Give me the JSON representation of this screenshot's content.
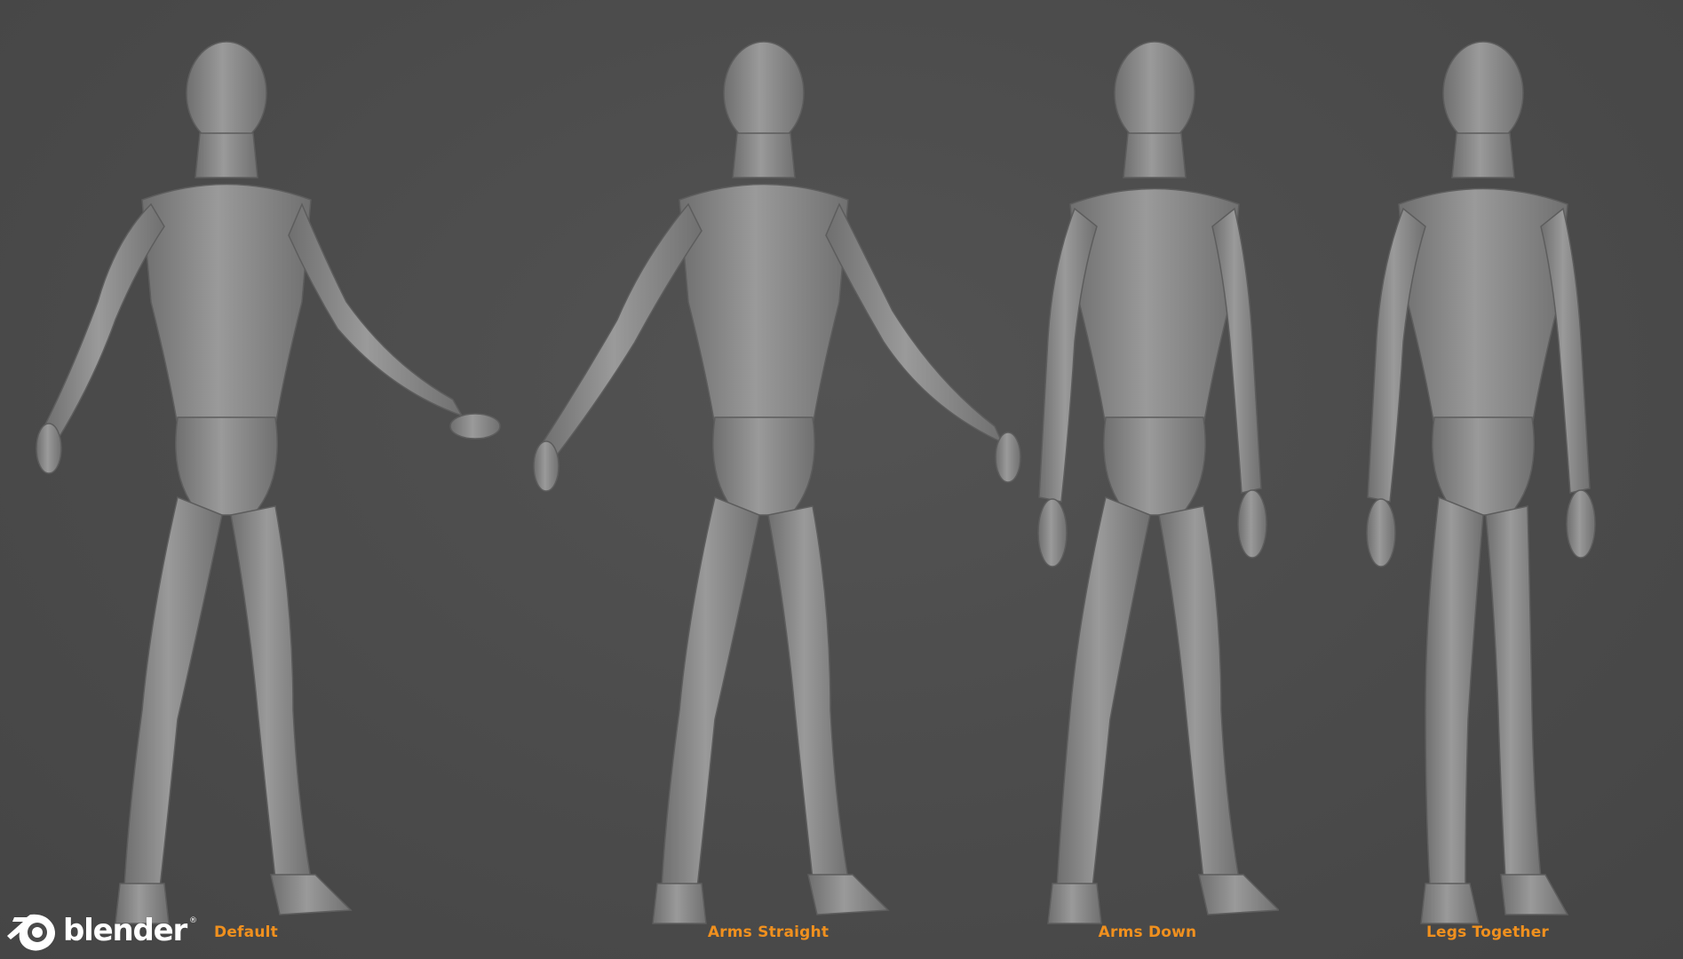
{
  "brand": {
    "name": "blender",
    "trademark": "®",
    "icon": "blender-logo-icon"
  },
  "poses": [
    {
      "label": "Default",
      "arms": "a-pose",
      "legs": "apart"
    },
    {
      "label": "Arms Straight",
      "arms": "a-pose-straight",
      "legs": "apart"
    },
    {
      "label": "Arms Down",
      "arms": "down",
      "legs": "apart"
    },
    {
      "label": "Legs Together",
      "arms": "down",
      "legs": "together"
    }
  ],
  "colors": {
    "background": "#4a4a4a",
    "label": "#f0901e",
    "body": "#8a8a8a",
    "logo": "#ffffff"
  }
}
